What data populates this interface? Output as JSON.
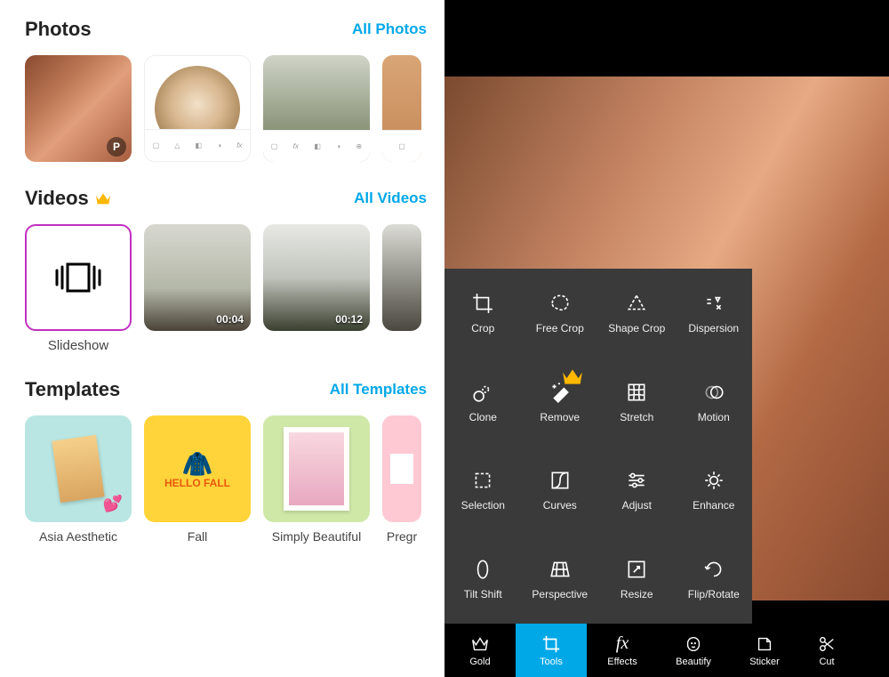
{
  "photos": {
    "title": "Photos",
    "link": "All Photos"
  },
  "videos": {
    "title": "Videos",
    "link": "All Videos",
    "items": [
      {
        "label": "Slideshow",
        "duration": ""
      },
      {
        "label": "",
        "duration": "00:04"
      },
      {
        "label": "",
        "duration": "00:12"
      }
    ]
  },
  "templates": {
    "title": "Templates",
    "link": "All Templates",
    "items": [
      {
        "label": "Asia Aesthetic",
        "color": "#b9e6e2"
      },
      {
        "label": "Fall",
        "color": "#ffd43b",
        "text": "HELLO FALL"
      },
      {
        "label": "Simply Beautiful",
        "color": "#cfe8a8"
      },
      {
        "label": "Pregr",
        "color": "#ffc9d4"
      }
    ]
  },
  "tools": [
    {
      "name": "crop",
      "label": "Crop"
    },
    {
      "name": "free-crop",
      "label": "Free Crop"
    },
    {
      "name": "shape-crop",
      "label": "Shape Crop"
    },
    {
      "name": "dispersion",
      "label": "Dispersion"
    },
    {
      "name": "clone",
      "label": "Clone"
    },
    {
      "name": "remove",
      "label": "Remove",
      "premium": true
    },
    {
      "name": "stretch",
      "label": "Stretch"
    },
    {
      "name": "motion",
      "label": "Motion"
    },
    {
      "name": "selection",
      "label": "Selection"
    },
    {
      "name": "curves",
      "label": "Curves"
    },
    {
      "name": "adjust",
      "label": "Adjust"
    },
    {
      "name": "enhance",
      "label": "Enhance"
    },
    {
      "name": "tilt-shift",
      "label": "Tilt Shift"
    },
    {
      "name": "perspective",
      "label": "Perspective"
    },
    {
      "name": "resize",
      "label": "Resize"
    },
    {
      "name": "flip-rotate",
      "label": "Flip/Rotate"
    }
  ],
  "bottom_nav": [
    {
      "name": "gold",
      "label": "Gold"
    },
    {
      "name": "tools",
      "label": "Tools",
      "active": true
    },
    {
      "name": "effects",
      "label": "Effects"
    },
    {
      "name": "beautify",
      "label": "Beautify"
    },
    {
      "name": "sticker",
      "label": "Sticker"
    },
    {
      "name": "cutout",
      "label": "Cut"
    }
  ]
}
